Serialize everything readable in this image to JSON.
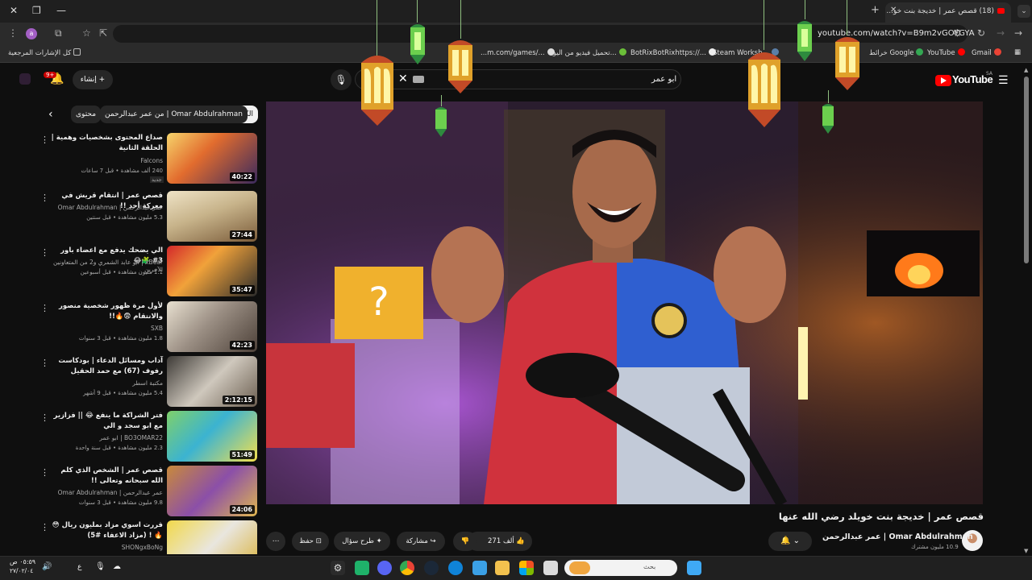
{
  "browser": {
    "tab_title": "(18) قصص عمر | خديجة بنت خو...",
    "url": "youtube.com/watch?v=B9m2vGOYGYA",
    "profile_initial": "a",
    "bookmarks": [
      {
        "label": "Gmail",
        "color": "#ea4335"
      },
      {
        "label": "YouTube",
        "color": "#ff0000"
      },
      {
        "label": "خرائط Google",
        "color": "#34a853"
      },
      {
        "label": "Steam Worksh...",
        "color": "#1b2838"
      },
      {
        "label": "BotRixBotRixhttps://...",
        "color": "#9146ff"
      },
      {
        "label": "تحميل فيديو من اليو...",
        "color": "#6bbf39"
      },
      {
        "label": "...m.com/games/...",
        "color": "#888888"
      },
      {
        "label": "كل الإشارات المرجعية",
        "color": "#bbbbbb"
      }
    ]
  },
  "youtube": {
    "logo": "YouTube",
    "region": "SA",
    "search_query": "ابو عمر",
    "create_label": "إنشاء",
    "notif_count": "9+"
  },
  "chips": {
    "all": "الكل",
    "channel": "من عمر عبدالرحمن | Omar Abdulrahman",
    "related": "محتوى"
  },
  "recommendations": [
    {
      "title": "صداع المحتوى بشخصيات وهمية | الحلقة الثانية",
      "channel": "Falcons",
      "meta": "240 ألف مشاهدة • قبل 7 ساعات",
      "duration": "40:22",
      "new_badge": "جديد"
    },
    {
      "title": "قصص عمر | انتقام قريش في معركة أحد !!",
      "channel": "عمر عبدالرحمن | Omar Abdulrahman",
      "meta": "5.3 مليون مشاهدة • قبل سنتين",
      "duration": "27:44"
    },
    {
      "title": "الي يضحك يدفع مع اعضاء باور 3# 🧩😂",
      "channel": "xBear | ابو عابد الشمري و2 من المتعاونين الآخرين",
      "meta": "1.1 مليون مشاهدة • قبل أسبوعين",
      "duration": "35:47"
    },
    {
      "title": "لأول مرة ظهور شخصية منصور والانتقام 😨🔥!!",
      "channel": "SXB",
      "meta": "1.8 مليون مشاهدة • قبل 3 سنوات",
      "duration": "42:23"
    },
    {
      "title": "آداب ومسائل الدعاء | بودكاست رفوف (67) مع حمد الحقيل",
      "channel": "مكتبة اسطر",
      "meta": "5.4 مليون مشاهدة • قبل 9 أشهر",
      "duration": "2:12:15"
    },
    {
      "title": "فتر الشراكة ما ينفع 😂 || فزازير مع ابو سجد و الي",
      "channel": "BO3OMAR22 | ابو عمر",
      "meta": "2.3 مليون مشاهدة • قبل سنة واحدة",
      "duration": "51:49"
    },
    {
      "title": "قصص عمر | الشخص الذي كلم الله سبحانه وتعالى !!",
      "channel": "عمر عبدالرحمن | Omar Abdulrahman",
      "meta": "9.8 مليون مشاهدة • قبل 3 سنوات",
      "duration": "24:06"
    },
    {
      "title": "قررت اسوي مزاد بمليون ريال 😳🔥 ! (مزاد الاعفاء #5)",
      "channel": "SHONgxBoNg",
      "meta": "",
      "duration": ""
    }
  ],
  "video": {
    "title": "قصص عمر | خديجة بنت خويلد رضي الله عنها",
    "channel": "عمر عبدالرحمن | Omar Abdulrahman",
    "subscribers": "10.9 مليون مشترك",
    "likes": "271 ألف",
    "share": "مشاركة",
    "ask": "طرح سؤال",
    "save": "حفظ"
  },
  "taskbar": {
    "search_placeholder": "بحث",
    "time": "٠٥:٥٩ ص",
    "date": "٢٧/٠٢/٠٤",
    "lang": "ع"
  },
  "colors": {
    "accent": "#ff0000",
    "bg": "#0f0f0f",
    "chip": "#272727"
  }
}
